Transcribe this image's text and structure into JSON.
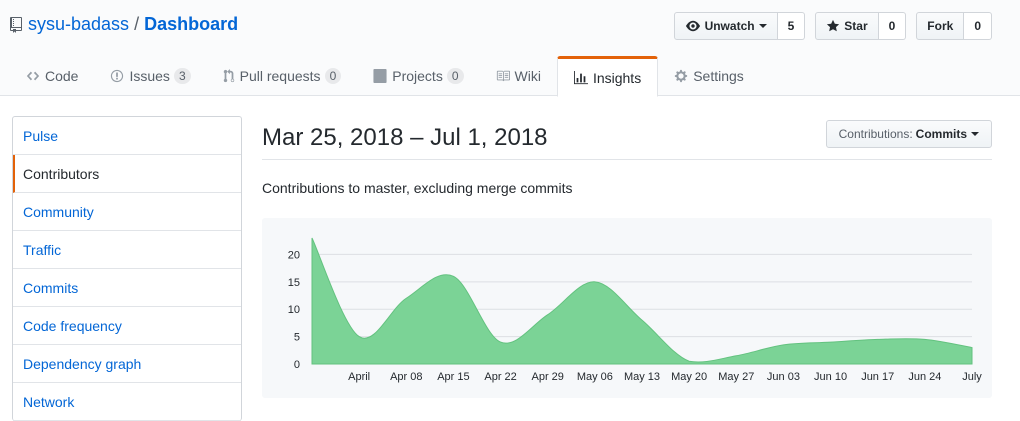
{
  "repo": {
    "owner": "sysu-badass",
    "separator": "/",
    "name": "Dashboard"
  },
  "actions": {
    "watch": {
      "label": "Unwatch",
      "count": "5"
    },
    "star": {
      "label": "Star",
      "count": "0"
    },
    "fork": {
      "label": "Fork",
      "count": "0"
    }
  },
  "tabs": [
    {
      "label": "Code",
      "icon": "code-icon",
      "count": ""
    },
    {
      "label": "Issues",
      "icon": "issue-icon",
      "count": "3"
    },
    {
      "label": "Pull requests",
      "icon": "pull-request-icon",
      "count": "0"
    },
    {
      "label": "Projects",
      "icon": "project-icon",
      "count": "0"
    },
    {
      "label": "Wiki",
      "icon": "book-icon",
      "count": ""
    },
    {
      "label": "Insights",
      "icon": "graph-icon",
      "count": "",
      "selected": true
    },
    {
      "label": "Settings",
      "icon": "gear-icon",
      "count": ""
    }
  ],
  "sidebar": {
    "items": [
      {
        "label": "Pulse"
      },
      {
        "label": "Contributors",
        "active": true
      },
      {
        "label": "Community"
      },
      {
        "label": "Traffic"
      },
      {
        "label": "Commits"
      },
      {
        "label": "Code frequency"
      },
      {
        "label": "Dependency graph"
      },
      {
        "label": "Network"
      }
    ]
  },
  "main": {
    "date_range": "Mar 25, 2018 – Jul 1, 2018",
    "dropdown_prefix": "Contributions:",
    "dropdown_value": "Commits",
    "subtitle": "Contributions to master, excluding merge commits"
  },
  "colors": {
    "accent": "#e36209",
    "link": "#0366d6",
    "area": "#7bd396"
  },
  "chart_data": {
    "type": "area",
    "x_ticks": [
      "April",
      "Apr 08",
      "Apr 15",
      "Apr 22",
      "Apr 29",
      "May 06",
      "May 13",
      "May 20",
      "May 27",
      "Jun 03",
      "Jun 10",
      "Jun 17",
      "Jun 24",
      "July"
    ],
    "y_ticks": [
      0,
      5,
      10,
      15,
      20
    ],
    "ylim": [
      0,
      23
    ],
    "x": [
      "Mar 25",
      "April",
      "Apr 08",
      "Apr 15",
      "Apr 22",
      "Apr 29",
      "May 06",
      "May 13",
      "May 20",
      "May 27",
      "Jun 03",
      "Jun 10",
      "Jun 17",
      "Jun 24",
      "July"
    ],
    "values": [
      23,
      5,
      12,
      16,
      4,
      9,
      15,
      8,
      0.5,
      1.5,
      3.5,
      4,
      4.5,
      4.5,
      3
    ],
    "grid": true
  }
}
